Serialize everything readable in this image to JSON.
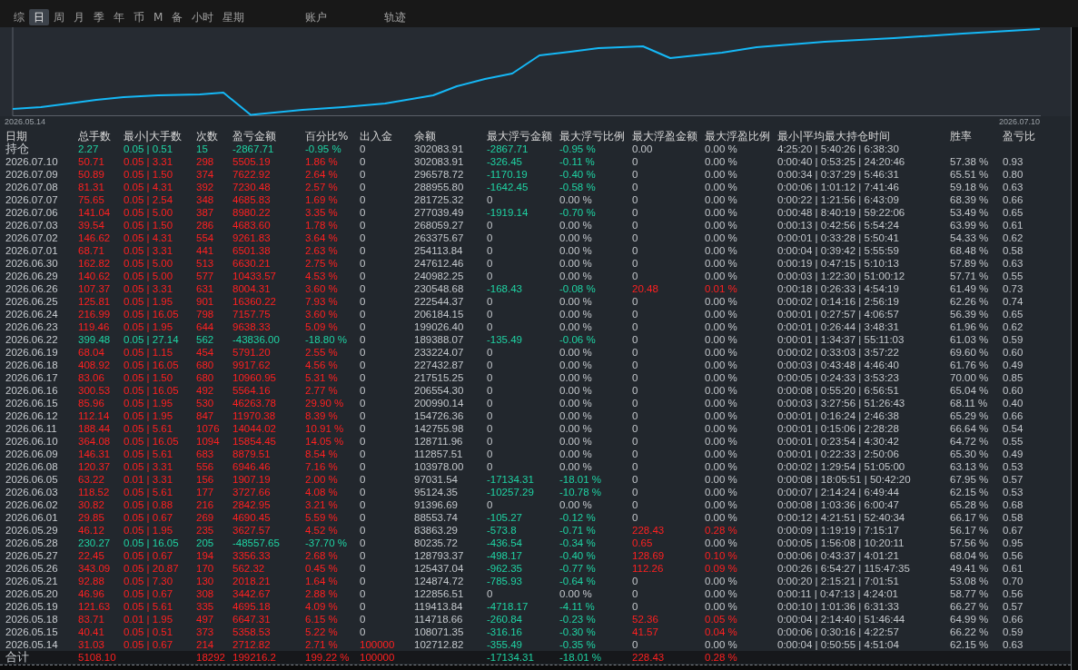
{
  "tabs": [
    {
      "label": "综",
      "selected": false
    },
    {
      "label": "日",
      "selected": true
    },
    {
      "label": "周",
      "selected": false
    },
    {
      "label": "月",
      "selected": false
    },
    {
      "label": "季",
      "selected": false
    },
    {
      "label": "年",
      "selected": false
    },
    {
      "label": "币",
      "selected": false
    },
    {
      "label": "M",
      "selected": false
    },
    {
      "label": "备",
      "selected": false
    },
    {
      "label": "小时",
      "selected": false
    },
    {
      "label": "星期",
      "selected": false
    }
  ],
  "panel_tabs": [
    {
      "label": "账户",
      "selected": false
    },
    {
      "label": "轨迹",
      "selected": false
    }
  ],
  "chart": {
    "start_label": "2026.05.14",
    "end_label": "2026.07.10"
  },
  "table": {
    "columns": [
      "日期",
      "总手数",
      "最小|大手数",
      "次数",
      "盈亏金额",
      "百分比%",
      "出入金",
      "余额",
      "最大浮亏金额",
      "最大浮亏比例",
      "最大浮盈金额",
      "最大浮盈比例",
      "最小|平均最大持仓时间",
      "胜率",
      "盈亏比"
    ],
    "position_row": {
      "date": "持仓",
      "kind": "loss",
      "lots": "2.27",
      "lot_range": "0.05 | 0.51",
      "trades": "15",
      "pnl": "-2867.71",
      "pct": "-0.95 %",
      "flow": "0",
      "flow_highlight": false,
      "balance": "302083.91",
      "float_loss": "-2867.71",
      "float_loss_pct": "-0.95 %",
      "float_loss_highlight": true,
      "float_profit": "0.00",
      "float_profit_highlight": false,
      "float_profit_pct": "0.00 %",
      "float_profit_pct_highlight": false,
      "hold_times": "4:25:20 | 5:40:26 | 6:38:30"
    },
    "rows": [
      {
        "date": "2026.07.10",
        "kind": "profit",
        "lots": "50.71",
        "lot_range": "0.05 | 3.31",
        "trades": "298",
        "pnl": "5505.19",
        "pct": "1.86 %",
        "flow": "0",
        "flow_highlight": false,
        "balance": "302083.91",
        "float_loss": "-326.45",
        "float_loss_pct": "-0.11 %",
        "float_loss_highlight": true,
        "float_profit": "0",
        "float_profit_highlight": false,
        "float_profit_pct": "0.00 %",
        "float_profit_pct_highlight": false,
        "hold_times": "0:00:40 | 0:53:25 | 24:20:46",
        "win_rate": "57.38 %",
        "pl_ratio": "0.93"
      },
      {
        "date": "2026.07.09",
        "kind": "profit",
        "lots": "50.89",
        "lot_range": "0.05 | 1.50",
        "trades": "374",
        "pnl": "7622.92",
        "pct": "2.64 %",
        "flow": "0",
        "flow_highlight": false,
        "balance": "296578.72",
        "float_loss": "-1170.19",
        "float_loss_pct": "-0.40 %",
        "float_loss_highlight": true,
        "float_profit": "0",
        "float_profit_highlight": false,
        "float_profit_pct": "0.00 %",
        "float_profit_pct_highlight": false,
        "hold_times": "0:00:34 | 0:37:29 | 5:46:31",
        "win_rate": "65.51 %",
        "pl_ratio": "0.80"
      },
      {
        "date": "2026.07.08",
        "kind": "profit",
        "lots": "81.31",
        "lot_range": "0.05 | 4.31",
        "trades": "392",
        "pnl": "7230.48",
        "pct": "2.57 %",
        "flow": "0",
        "flow_highlight": false,
        "balance": "288955.80",
        "float_loss": "-1642.45",
        "float_loss_pct": "-0.58 %",
        "float_loss_highlight": true,
        "float_profit": "0",
        "float_profit_highlight": false,
        "float_profit_pct": "0.00 %",
        "float_profit_pct_highlight": false,
        "hold_times": "0:00:06 | 1:01:12 | 7:41:46",
        "win_rate": "59.18 %",
        "pl_ratio": "0.63"
      },
      {
        "date": "2026.07.07",
        "kind": "profit",
        "lots": "75.65",
        "lot_range": "0.05 | 2.54",
        "trades": "348",
        "pnl": "4685.83",
        "pct": "1.69 %",
        "flow": "0",
        "flow_highlight": false,
        "balance": "281725.32",
        "float_loss": "0",
        "float_loss_pct": "0.00 %",
        "float_loss_highlight": false,
        "float_profit": "0",
        "float_profit_highlight": false,
        "float_profit_pct": "0.00 %",
        "float_profit_pct_highlight": false,
        "hold_times": "0:00:22 | 1:21:56 | 6:43:09",
        "win_rate": "68.39 %",
        "pl_ratio": "0.66"
      },
      {
        "date": "2026.07.06",
        "kind": "profit",
        "lots": "141.04",
        "lot_range": "0.05 | 5.00",
        "trades": "387",
        "pnl": "8980.22",
        "pct": "3.35 %",
        "flow": "0",
        "flow_highlight": false,
        "balance": "277039.49",
        "float_loss": "-1919.14",
        "float_loss_pct": "-0.70 %",
        "float_loss_highlight": true,
        "float_profit": "0",
        "float_profit_highlight": false,
        "float_profit_pct": "0.00 %",
        "float_profit_pct_highlight": false,
        "hold_times": "0:00:48 | 8:40:19 | 59:22:06",
        "win_rate": "53.49 %",
        "pl_ratio": "0.65"
      },
      {
        "date": "2026.07.03",
        "kind": "profit",
        "lots": "39.54",
        "lot_range": "0.05 | 1.50",
        "trades": "286",
        "pnl": "4683.60",
        "pct": "1.78 %",
        "flow": "0",
        "flow_highlight": false,
        "balance": "268059.27",
        "float_loss": "0",
        "float_loss_pct": "0.00 %",
        "float_loss_highlight": false,
        "float_profit": "0",
        "float_profit_highlight": false,
        "float_profit_pct": "0.00 %",
        "float_profit_pct_highlight": false,
        "hold_times": "0:00:13 | 0:42:56 | 5:54:24",
        "win_rate": "63.99 %",
        "pl_ratio": "0.61"
      },
      {
        "date": "2026.07.02",
        "kind": "profit",
        "lots": "146.62",
        "lot_range": "0.05 | 4.31",
        "trades": "554",
        "pnl": "9261.83",
        "pct": "3.64 %",
        "flow": "0",
        "flow_highlight": false,
        "balance": "263375.67",
        "float_loss": "0",
        "float_loss_pct": "0.00 %",
        "float_loss_highlight": false,
        "float_profit": "0",
        "float_profit_highlight": false,
        "float_profit_pct": "0.00 %",
        "float_profit_pct_highlight": false,
        "hold_times": "0:00:01 | 0:33:28 | 5:50:41",
        "win_rate": "54.33 %",
        "pl_ratio": "0.62"
      },
      {
        "date": "2026.07.01",
        "kind": "profit",
        "lots": "68.71",
        "lot_range": "0.05 | 3.31",
        "trades": "441",
        "pnl": "6501.38",
        "pct": "2.63 %",
        "flow": "0",
        "flow_highlight": false,
        "balance": "254113.84",
        "float_loss": "0",
        "float_loss_pct": "0.00 %",
        "float_loss_highlight": false,
        "float_profit": "0",
        "float_profit_highlight": false,
        "float_profit_pct": "0.00 %",
        "float_profit_pct_highlight": false,
        "hold_times": "0:00:04 | 0:39:42 | 5:55:59",
        "win_rate": "68.48 %",
        "pl_ratio": "0.58"
      },
      {
        "date": "2026.06.30",
        "kind": "profit",
        "lots": "162.82",
        "lot_range": "0.05 | 5.00",
        "trades": "513",
        "pnl": "6630.21",
        "pct": "2.75 %",
        "flow": "0",
        "flow_highlight": false,
        "balance": "247612.46",
        "float_loss": "0",
        "float_loss_pct": "0.00 %",
        "float_loss_highlight": false,
        "float_profit": "0",
        "float_profit_highlight": false,
        "float_profit_pct": "0.00 %",
        "float_profit_pct_highlight": false,
        "hold_times": "0:00:19 | 0:47:15 | 5:10:13",
        "win_rate": "57.89 %",
        "pl_ratio": "0.63"
      },
      {
        "date": "2026.06.29",
        "kind": "profit",
        "lots": "140.62",
        "lot_range": "0.05 | 5.00",
        "trades": "577",
        "pnl": "10433.57",
        "pct": "4.53 %",
        "flow": "0",
        "flow_highlight": false,
        "balance": "240982.25",
        "float_loss": "0",
        "float_loss_pct": "0.00 %",
        "float_loss_highlight": false,
        "float_profit": "0",
        "float_profit_highlight": false,
        "float_profit_pct": "0.00 %",
        "float_profit_pct_highlight": false,
        "hold_times": "0:00:03 | 1:22:30 | 51:00:12",
        "win_rate": "57.71 %",
        "pl_ratio": "0.55"
      },
      {
        "date": "2026.06.26",
        "kind": "profit",
        "lots": "107.37",
        "lot_range": "0.05 | 3.31",
        "trades": "631",
        "pnl": "8004.31",
        "pct": "3.60 %",
        "flow": "0",
        "flow_highlight": false,
        "balance": "230548.68",
        "float_loss": "-168.43",
        "float_loss_pct": "-0.08 %",
        "float_loss_highlight": true,
        "float_profit": "20.48",
        "float_profit_highlight": true,
        "float_profit_pct": "0.01 %",
        "float_profit_pct_highlight": true,
        "hold_times": "0:00:18 | 0:26:33 | 4:54:19",
        "win_rate": "61.49 %",
        "pl_ratio": "0.73"
      },
      {
        "date": "2026.06.25",
        "kind": "profit",
        "lots": "125.81",
        "lot_range": "0.05 | 1.95",
        "trades": "901",
        "pnl": "16360.22",
        "pct": "7.93 %",
        "flow": "0",
        "flow_highlight": false,
        "balance": "222544.37",
        "float_loss": "0",
        "float_loss_pct": "0.00 %",
        "float_loss_highlight": false,
        "float_profit": "0",
        "float_profit_highlight": false,
        "float_profit_pct": "0.00 %",
        "float_profit_pct_highlight": false,
        "hold_times": "0:00:02 | 0:14:16 | 2:56:19",
        "win_rate": "62.26 %",
        "pl_ratio": "0.74"
      },
      {
        "date": "2026.06.24",
        "kind": "profit",
        "lots": "216.99",
        "lot_range": "0.05 | 16.05",
        "trades": "798",
        "pnl": "7157.75",
        "pct": "3.60 %",
        "flow": "0",
        "flow_highlight": false,
        "balance": "206184.15",
        "float_loss": "0",
        "float_loss_pct": "0.00 %",
        "float_loss_highlight": false,
        "float_profit": "0",
        "float_profit_highlight": false,
        "float_profit_pct": "0.00 %",
        "float_profit_pct_highlight": false,
        "hold_times": "0:00:01 | 0:27:57 | 4:06:57",
        "win_rate": "56.39 %",
        "pl_ratio": "0.65"
      },
      {
        "date": "2026.06.23",
        "kind": "profit",
        "lots": "119.46",
        "lot_range": "0.05 | 1.95",
        "trades": "644",
        "pnl": "9638.33",
        "pct": "5.09 %",
        "flow": "0",
        "flow_highlight": false,
        "balance": "199026.40",
        "float_loss": "0",
        "float_loss_pct": "0.00 %",
        "float_loss_highlight": false,
        "float_profit": "0",
        "float_profit_highlight": false,
        "float_profit_pct": "0.00 %",
        "float_profit_pct_highlight": false,
        "hold_times": "0:00:01 | 0:26:44 | 3:48:31",
        "win_rate": "61.96 %",
        "pl_ratio": "0.62"
      },
      {
        "date": "2026.06.22",
        "kind": "loss",
        "lots": "399.48",
        "lot_range": "0.05 | 27.14",
        "trades": "562",
        "pnl": "-43836.00",
        "pct": "-18.80 %",
        "flow": "0",
        "flow_highlight": false,
        "balance": "189388.07",
        "float_loss": "-135.49",
        "float_loss_pct": "-0.06 %",
        "float_loss_highlight": true,
        "float_profit": "0",
        "float_profit_highlight": false,
        "float_profit_pct": "0.00 %",
        "float_profit_pct_highlight": false,
        "hold_times": "0:00:01 | 1:34:37 | 55:11:03",
        "win_rate": "61.03 %",
        "pl_ratio": "0.59"
      },
      {
        "date": "2026.06.19",
        "kind": "profit",
        "lots": "68.04",
        "lot_range": "0.05 | 1.15",
        "trades": "454",
        "pnl": "5791.20",
        "pct": "2.55 %",
        "flow": "0",
        "flow_highlight": false,
        "balance": "233224.07",
        "float_loss": "0",
        "float_loss_pct": "0.00 %",
        "float_loss_highlight": false,
        "float_profit": "0",
        "float_profit_highlight": false,
        "float_profit_pct": "0.00 %",
        "float_profit_pct_highlight": false,
        "hold_times": "0:00:02 | 0:33:03 | 3:57:22",
        "win_rate": "69.60 %",
        "pl_ratio": "0.60"
      },
      {
        "date": "2026.06.18",
        "kind": "profit",
        "lots": "408.92",
        "lot_range": "0.05 | 16.05",
        "trades": "680",
        "pnl": "9917.62",
        "pct": "4.56 %",
        "flow": "0",
        "flow_highlight": false,
        "balance": "227432.87",
        "float_loss": "0",
        "float_loss_pct": "0.00 %",
        "float_loss_highlight": false,
        "float_profit": "0",
        "float_profit_highlight": false,
        "float_profit_pct": "0.00 %",
        "float_profit_pct_highlight": false,
        "hold_times": "0:00:03 | 0:43:48 | 4:46:40",
        "win_rate": "61.76 %",
        "pl_ratio": "0.49"
      },
      {
        "date": "2026.06.17",
        "kind": "profit",
        "lots": "83.06",
        "lot_range": "0.05 | 1.50",
        "trades": "680",
        "pnl": "10960.95",
        "pct": "5.31 %",
        "flow": "0",
        "flow_highlight": false,
        "balance": "217515.25",
        "float_loss": "0",
        "float_loss_pct": "0.00 %",
        "float_loss_highlight": false,
        "float_profit": "0",
        "float_profit_highlight": false,
        "float_profit_pct": "0.00 %",
        "float_profit_pct_highlight": false,
        "hold_times": "0:00:05 | 0:24:33 | 3:53:23",
        "win_rate": "70.00 %",
        "pl_ratio": "0.85"
      },
      {
        "date": "2026.06.16",
        "kind": "profit",
        "lots": "300.53",
        "lot_range": "0.05 | 16.05",
        "trades": "492",
        "pnl": "5564.16",
        "pct": "2.77 %",
        "flow": "0",
        "flow_highlight": false,
        "balance": "206554.30",
        "float_loss": "0",
        "float_loss_pct": "0.00 %",
        "float_loss_highlight": false,
        "float_profit": "0",
        "float_profit_highlight": false,
        "float_profit_pct": "0.00 %",
        "float_profit_pct_highlight": false,
        "hold_times": "0:00:08 | 0:55:20 | 6:56:51",
        "win_rate": "65.04 %",
        "pl_ratio": "0.60"
      },
      {
        "date": "2026.06.15",
        "kind": "profit",
        "lots": "85.96",
        "lot_range": "0.05 | 1.95",
        "trades": "530",
        "pnl": "46263.78",
        "pct": "29.90 %",
        "flow": "0",
        "flow_highlight": false,
        "balance": "200990.14",
        "float_loss": "0",
        "float_loss_pct": "0.00 %",
        "float_loss_highlight": false,
        "float_profit": "0",
        "float_profit_highlight": false,
        "float_profit_pct": "0.00 %",
        "float_profit_pct_highlight": false,
        "hold_times": "0:00:03 | 3:27:56 | 51:26:43",
        "win_rate": "68.11 %",
        "pl_ratio": "0.40"
      },
      {
        "date": "2026.06.12",
        "kind": "profit",
        "lots": "112.14",
        "lot_range": "0.05 | 1.95",
        "trades": "847",
        "pnl": "11970.38",
        "pct": "8.39 %",
        "flow": "0",
        "flow_highlight": false,
        "balance": "154726.36",
        "float_loss": "0",
        "float_loss_pct": "0.00 %",
        "float_loss_highlight": false,
        "float_profit": "0",
        "float_profit_highlight": false,
        "float_profit_pct": "0.00 %",
        "float_profit_pct_highlight": false,
        "hold_times": "0:00:01 | 0:16:24 | 2:46:38",
        "win_rate": "65.29 %",
        "pl_ratio": "0.66"
      },
      {
        "date": "2026.06.11",
        "kind": "profit",
        "lots": "188.44",
        "lot_range": "0.05 | 5.61",
        "trades": "1076",
        "pnl": "14044.02",
        "pct": "10.91 %",
        "flow": "0",
        "flow_highlight": false,
        "balance": "142755.98",
        "float_loss": "0",
        "float_loss_pct": "0.00 %",
        "float_loss_highlight": false,
        "float_profit": "0",
        "float_profit_highlight": false,
        "float_profit_pct": "0.00 %",
        "float_profit_pct_highlight": false,
        "hold_times": "0:00:01 | 0:15:06 | 2:28:28",
        "win_rate": "66.64 %",
        "pl_ratio": "0.54"
      },
      {
        "date": "2026.06.10",
        "kind": "profit",
        "lots": "364.08",
        "lot_range": "0.05 | 16.05",
        "trades": "1094",
        "pnl": "15854.45",
        "pct": "14.05 %",
        "flow": "0",
        "flow_highlight": false,
        "balance": "128711.96",
        "float_loss": "0",
        "float_loss_pct": "0.00 %",
        "float_loss_highlight": false,
        "float_profit": "0",
        "float_profit_highlight": false,
        "float_profit_pct": "0.00 %",
        "float_profit_pct_highlight": false,
        "hold_times": "0:00:01 | 0:23:54 | 4:30:42",
        "win_rate": "64.72 %",
        "pl_ratio": "0.55"
      },
      {
        "date": "2026.06.09",
        "kind": "profit",
        "lots": "146.31",
        "lot_range": "0.05 | 5.61",
        "trades": "683",
        "pnl": "8879.51",
        "pct": "8.54 %",
        "flow": "0",
        "flow_highlight": false,
        "balance": "112857.51",
        "float_loss": "0",
        "float_loss_pct": "0.00 %",
        "float_loss_highlight": false,
        "float_profit": "0",
        "float_profit_highlight": false,
        "float_profit_pct": "0.00 %",
        "float_profit_pct_highlight": false,
        "hold_times": "0:00:01 | 0:22:33 | 2:50:06",
        "win_rate": "65.30 %",
        "pl_ratio": "0.49"
      },
      {
        "date": "2026.06.08",
        "kind": "profit",
        "lots": "120.37",
        "lot_range": "0.05 | 3.31",
        "trades": "556",
        "pnl": "6946.46",
        "pct": "7.16 %",
        "flow": "0",
        "flow_highlight": false,
        "balance": "103978.00",
        "float_loss": "0",
        "float_loss_pct": "0.00 %",
        "float_loss_highlight": false,
        "float_profit": "0",
        "float_profit_highlight": false,
        "float_profit_pct": "0.00 %",
        "float_profit_pct_highlight": false,
        "hold_times": "0:00:02 | 1:29:54 | 51:05:00",
        "win_rate": "63.13 %",
        "pl_ratio": "0.53"
      },
      {
        "date": "2026.06.05",
        "kind": "profit",
        "lots": "63.22",
        "lot_range": "0.01 | 3.31",
        "trades": "156",
        "pnl": "1907.19",
        "pct": "2.00 %",
        "flow": "0",
        "flow_highlight": false,
        "balance": "97031.54",
        "float_loss": "-17134.31",
        "float_loss_pct": "-18.01 %",
        "float_loss_highlight": true,
        "float_profit": "0",
        "float_profit_highlight": false,
        "float_profit_pct": "0.00 %",
        "float_profit_pct_highlight": false,
        "hold_times": "0:00:08 | 18:05:51 | 50:42:20",
        "win_rate": "67.95 %",
        "pl_ratio": "0.57"
      },
      {
        "date": "2026.06.03",
        "kind": "profit",
        "lots": "118.52",
        "lot_range": "0.05 | 5.61",
        "trades": "177",
        "pnl": "3727.66",
        "pct": "4.08 %",
        "flow": "0",
        "flow_highlight": false,
        "balance": "95124.35",
        "float_loss": "-10257.29",
        "float_loss_pct": "-10.78 %",
        "float_loss_highlight": true,
        "float_profit": "0",
        "float_profit_highlight": false,
        "float_profit_pct": "0.00 %",
        "float_profit_pct_highlight": false,
        "hold_times": "0:00:07 | 2:14:24 | 6:49:44",
        "win_rate": "62.15 %",
        "pl_ratio": "0.53"
      },
      {
        "date": "2026.06.02",
        "kind": "profit",
        "lots": "30.82",
        "lot_range": "0.05 | 0.88",
        "trades": "216",
        "pnl": "2842.95",
        "pct": "3.21 %",
        "flow": "0",
        "flow_highlight": false,
        "balance": "91396.69",
        "float_loss": "0",
        "float_loss_pct": "0.00 %",
        "float_loss_highlight": false,
        "float_profit": "0",
        "float_profit_highlight": false,
        "float_profit_pct": "0.00 %",
        "float_profit_pct_highlight": false,
        "hold_times": "0:00:08 | 1:03:36 | 6:00:47",
        "win_rate": "65.28 %",
        "pl_ratio": "0.68"
      },
      {
        "date": "2026.06.01",
        "kind": "profit",
        "lots": "29.85",
        "lot_range": "0.05 | 0.67",
        "trades": "269",
        "pnl": "4690.45",
        "pct": "5.59 %",
        "flow": "0",
        "flow_highlight": false,
        "balance": "88553.74",
        "float_loss": "-105.27",
        "float_loss_pct": "-0.12 %",
        "float_loss_highlight": true,
        "float_profit": "0",
        "float_profit_highlight": false,
        "float_profit_pct": "0.00 %",
        "float_profit_pct_highlight": false,
        "hold_times": "0:00:12 | 4:21:51 | 52:40:34",
        "win_rate": "66.17 %",
        "pl_ratio": "0.58"
      },
      {
        "date": "2026.05.29",
        "kind": "profit",
        "lots": "46.12",
        "lot_range": "0.05 | 1.95",
        "trades": "235",
        "pnl": "3627.57",
        "pct": "4.52 %",
        "flow": "0",
        "flow_highlight": false,
        "balance": "83863.29",
        "float_loss": "-573.8",
        "float_loss_pct": "-0.71 %",
        "float_loss_highlight": true,
        "float_profit": "228.43",
        "float_profit_highlight": true,
        "float_profit_pct": "0.28 %",
        "float_profit_pct_highlight": true,
        "hold_times": "0:00:09 | 1:19:19 | 7:15:17",
        "win_rate": "56.17 %",
        "pl_ratio": "0.67"
      },
      {
        "date": "2026.05.28",
        "kind": "loss",
        "lots": "230.27",
        "lot_range": "0.05 | 16.05",
        "trades": "205",
        "pnl": "-48557.65",
        "pct": "-37.70 %",
        "flow": "0",
        "flow_highlight": false,
        "balance": "80235.72",
        "float_loss": "-436.54",
        "float_loss_pct": "-0.34 %",
        "float_loss_highlight": true,
        "float_profit": "0.65",
        "float_profit_highlight": true,
        "float_profit_pct": "0.00 %",
        "float_profit_pct_highlight": false,
        "hold_times": "0:00:05 | 1:56:08 | 10:20:11",
        "win_rate": "57.56 %",
        "pl_ratio": "0.95"
      },
      {
        "date": "2026.05.27",
        "kind": "profit",
        "lots": "22.45",
        "lot_range": "0.05 | 0.67",
        "trades": "194",
        "pnl": "3356.33",
        "pct": "2.68 %",
        "flow": "0",
        "flow_highlight": false,
        "balance": "128793.37",
        "float_loss": "-498.17",
        "float_loss_pct": "-0.40 %",
        "float_loss_highlight": true,
        "float_profit": "128.69",
        "float_profit_highlight": true,
        "float_profit_pct": "0.10 %",
        "float_profit_pct_highlight": true,
        "hold_times": "0:00:06 | 0:43:37 | 4:01:21",
        "win_rate": "68.04 %",
        "pl_ratio": "0.56"
      },
      {
        "date": "2026.05.26",
        "kind": "profit",
        "lots": "343.09",
        "lot_range": "0.05 | 20.87",
        "trades": "170",
        "pnl": "562.32",
        "pct": "0.45 %",
        "flow": "0",
        "flow_highlight": false,
        "balance": "125437.04",
        "float_loss": "-962.35",
        "float_loss_pct": "-0.77 %",
        "float_loss_highlight": true,
        "float_profit": "112.26",
        "float_profit_highlight": true,
        "float_profit_pct": "0.09 %",
        "float_profit_pct_highlight": true,
        "hold_times": "0:00:26 | 6:54:27 | 115:47:35",
        "win_rate": "49.41 %",
        "pl_ratio": "0.61"
      },
      {
        "date": "2026.05.21",
        "kind": "profit",
        "lots": "92.88",
        "lot_range": "0.05 | 7.30",
        "trades": "130",
        "pnl": "2018.21",
        "pct": "1.64 %",
        "flow": "0",
        "flow_highlight": false,
        "balance": "124874.72",
        "float_loss": "-785.93",
        "float_loss_pct": "-0.64 %",
        "float_loss_highlight": true,
        "float_profit": "0",
        "float_profit_highlight": false,
        "float_profit_pct": "0.00 %",
        "float_profit_pct_highlight": false,
        "hold_times": "0:00:20 | 2:15:21 | 7:01:51",
        "win_rate": "53.08 %",
        "pl_ratio": "0.70"
      },
      {
        "date": "2026.05.20",
        "kind": "profit",
        "lots": "46.96",
        "lot_range": "0.05 | 0.67",
        "trades": "308",
        "pnl": "3442.67",
        "pct": "2.88 %",
        "flow": "0",
        "flow_highlight": false,
        "balance": "122856.51",
        "float_loss": "0",
        "float_loss_pct": "0.00 %",
        "float_loss_highlight": false,
        "float_profit": "0",
        "float_profit_highlight": false,
        "float_profit_pct": "0.00 %",
        "float_profit_pct_highlight": false,
        "hold_times": "0:00:11 | 0:47:13 | 4:24:01",
        "win_rate": "58.77 %",
        "pl_ratio": "0.56"
      },
      {
        "date": "2026.05.19",
        "kind": "profit",
        "lots": "121.63",
        "lot_range": "0.05 | 5.61",
        "trades": "335",
        "pnl": "4695.18",
        "pct": "4.09 %",
        "flow": "0",
        "flow_highlight": false,
        "balance": "119413.84",
        "float_loss": "-4718.17",
        "float_loss_pct": "-4.11 %",
        "float_loss_highlight": true,
        "float_profit": "0",
        "float_profit_highlight": false,
        "float_profit_pct": "0.00 %",
        "float_profit_pct_highlight": false,
        "hold_times": "0:00:10 | 1:01:36 | 6:31:33",
        "win_rate": "66.27 %",
        "pl_ratio": "0.57"
      },
      {
        "date": "2026.05.18",
        "kind": "profit",
        "lots": "83.71",
        "lot_range": "0.01 | 1.95",
        "trades": "497",
        "pnl": "6647.31",
        "pct": "6.15 %",
        "flow": "0",
        "flow_highlight": false,
        "balance": "114718.66",
        "float_loss": "-260.84",
        "float_loss_pct": "-0.23 %",
        "float_loss_highlight": true,
        "float_profit": "52.36",
        "float_profit_highlight": true,
        "float_profit_pct": "0.05 %",
        "float_profit_pct_highlight": true,
        "hold_times": "0:00:04 | 2:14:40 | 51:46:44",
        "win_rate": "64.99 %",
        "pl_ratio": "0.66"
      },
      {
        "date": "2026.05.15",
        "kind": "profit",
        "lots": "40.41",
        "lot_range": "0.05 | 0.51",
        "trades": "373",
        "pnl": "5358.53",
        "pct": "5.22 %",
        "flow": "0",
        "flow_highlight": false,
        "balance": "108071.35",
        "float_loss": "-316.16",
        "float_loss_pct": "-0.30 %",
        "float_loss_highlight": true,
        "float_profit": "41.57",
        "float_profit_highlight": true,
        "float_profit_pct": "0.04 %",
        "float_profit_pct_highlight": true,
        "hold_times": "0:00:06 | 0:30:16 | 4:22:57",
        "win_rate": "66.22 %",
        "pl_ratio": "0.59"
      },
      {
        "date": "2026.05.14",
        "kind": "profit",
        "lots": "31.03",
        "lot_range": "0.05 | 0.67",
        "trades": "214",
        "pnl": "2712.82",
        "pct": "2.71 %",
        "flow": "100000",
        "flow_highlight": true,
        "balance": "102712.82",
        "float_loss": "-355.49",
        "float_loss_pct": "-0.35 %",
        "float_loss_highlight": true,
        "float_profit": "0",
        "float_profit_highlight": false,
        "float_profit_pct": "0.00 %",
        "float_profit_pct_highlight": false,
        "hold_times": "0:00:04 | 0:50:55 | 4:51:04",
        "win_rate": "62.15 %",
        "pl_ratio": "0.63"
      }
    ],
    "total_row": {
      "date": "合计",
      "kind": "profit",
      "lots": "5108.10",
      "trades": "18292",
      "pnl": "199216.2",
      "pct": "199.22 %",
      "flow": "100000",
      "flow_highlight": true,
      "float_loss": "-17134.31",
      "float_loss_pct": "-18.01 %",
      "float_loss_highlight": true,
      "float_profit": "228.43",
      "float_profit_highlight": true,
      "float_profit_pct": "0.28 %",
      "float_profit_pct_highlight": true
    }
  }
}
